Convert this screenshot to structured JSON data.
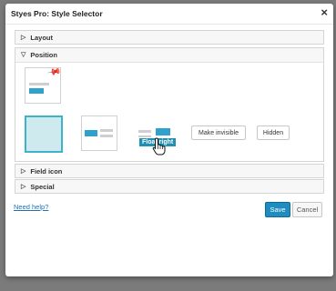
{
  "dialog": {
    "title": "Styes Pro: Style Selector",
    "close_symbol": "×"
  },
  "panels": {
    "layout": {
      "label": "Layout",
      "expanded": false
    },
    "position": {
      "label": "Position",
      "expanded": true
    },
    "field_icon": {
      "label": "Field icon",
      "expanded": false
    },
    "special": {
      "label": "Special",
      "expanded": false
    }
  },
  "position_options": {
    "tooltip": "Float right",
    "make_invisible_label": "Make invisible",
    "hidden_label": "Hidden"
  },
  "footer": {
    "help_link": "Need help?",
    "save_label": "Save",
    "cancel_label": "Cancel"
  },
  "colors": {
    "accent": "#2ea2cc",
    "primary_button": "#1e8cbe",
    "selected_fill": "#cfeaee",
    "link": "#2271b1"
  },
  "icons": {
    "collapsed": "triangle-right-icon",
    "expanded": "triangle-down-icon",
    "pin": "pin-icon",
    "cursor": "hand-pointer-icon",
    "close": "close-icon"
  }
}
